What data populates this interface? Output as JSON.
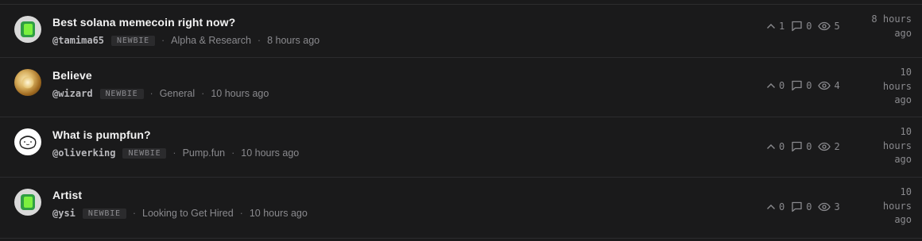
{
  "threads": [
    {
      "title": "Best solana memecoin right now?",
      "username": "@tamima65",
      "badge": "NEWBIE",
      "category": "Alpha & Research",
      "posted": "8 hours ago",
      "upvotes": "1",
      "comments": "0",
      "views": "5",
      "time_line1": "8 hours",
      "time_line2": "ago",
      "time_line3": "",
      "avatar": "default-chat-icon"
    },
    {
      "title": "Believe",
      "username": "@wizard",
      "badge": "NEWBIE",
      "category": "General",
      "posted": "10 hours ago",
      "upvotes": "0",
      "comments": "0",
      "views": "4",
      "time_line1": "10",
      "time_line2": "hours",
      "time_line3": "ago",
      "avatar": "gold-image"
    },
    {
      "title": "What is pumpfun?",
      "username": "@oliverking",
      "badge": "NEWBIE",
      "category": "Pump.fun",
      "posted": "10 hours ago",
      "upvotes": "0",
      "comments": "0",
      "views": "2",
      "time_line1": "10",
      "time_line2": "hours",
      "time_line3": "ago",
      "avatar": "face-sketch"
    },
    {
      "title": "Artist",
      "username": "@ysi",
      "badge": "NEWBIE",
      "category": "Looking to Get Hired",
      "posted": "10 hours ago",
      "upvotes": "0",
      "comments": "0",
      "views": "3",
      "time_line1": "10",
      "time_line2": "hours",
      "time_line3": "ago",
      "avatar": "default-chat-icon"
    }
  ],
  "separator": "·",
  "colors": {
    "background": "#1a1a1b",
    "divider": "#2c2c2e",
    "title": "#f2f2f2",
    "muted": "#8a8a8e",
    "badge_bg": "#2b2b2d",
    "avatar_green": "#7cf03f"
  }
}
